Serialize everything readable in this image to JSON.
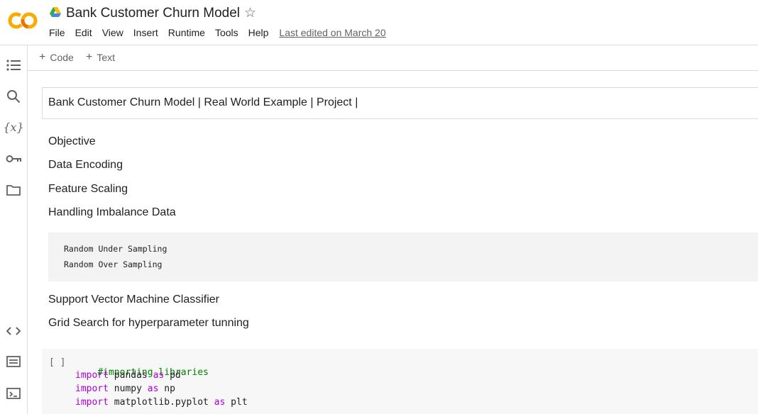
{
  "header": {
    "logo_text": "CO",
    "title": "Bank Customer Churn Model",
    "star_icon": "star-outline-icon",
    "menu": [
      "File",
      "Edit",
      "View",
      "Insert",
      "Runtime",
      "Tools",
      "Help"
    ],
    "last_edited": "Last edited on March 20"
  },
  "colors": {
    "logo_orange": "#f9ab00",
    "logo_dark_orange": "#e8710a",
    "keyword": "#af00db",
    "comment": "#008000"
  },
  "rail": {
    "icons": [
      "table-of-contents-icon",
      "search-icon",
      "variables-icon",
      "secrets-key-icon",
      "files-folder-icon",
      "code-snippets-icon",
      "command-palette-icon",
      "terminal-icon"
    ],
    "variables_glyph": "{x}"
  },
  "toolbar": {
    "code_label": "Code",
    "text_label": "Text",
    "plus": "+"
  },
  "notebook": {
    "title_cell": "Bank Customer Churn Model | Real World Example | Project |",
    "items": [
      "Objective",
      "Data Encoding",
      "Feature Scaling",
      "Handling Imbalance Data"
    ],
    "code_block": [
      "Random Under Sampling",
      "Random Over Sampling"
    ],
    "items2": [
      "Support Vector Machine Classifier",
      "Grid Search for hyperparameter tunning"
    ],
    "code_cell": {
      "run_indicator": "[ ]",
      "comment": "#importing libraries",
      "imports": [
        {
          "kw": "import",
          "module": "pandas",
          "as": "as",
          "alias": "pd"
        },
        {
          "kw": "import",
          "module": "numpy",
          "as": "as",
          "alias": "np"
        },
        {
          "kw": "import",
          "module": "matplotlib.pyplot",
          "as": "as",
          "alias": "plt"
        }
      ]
    }
  }
}
